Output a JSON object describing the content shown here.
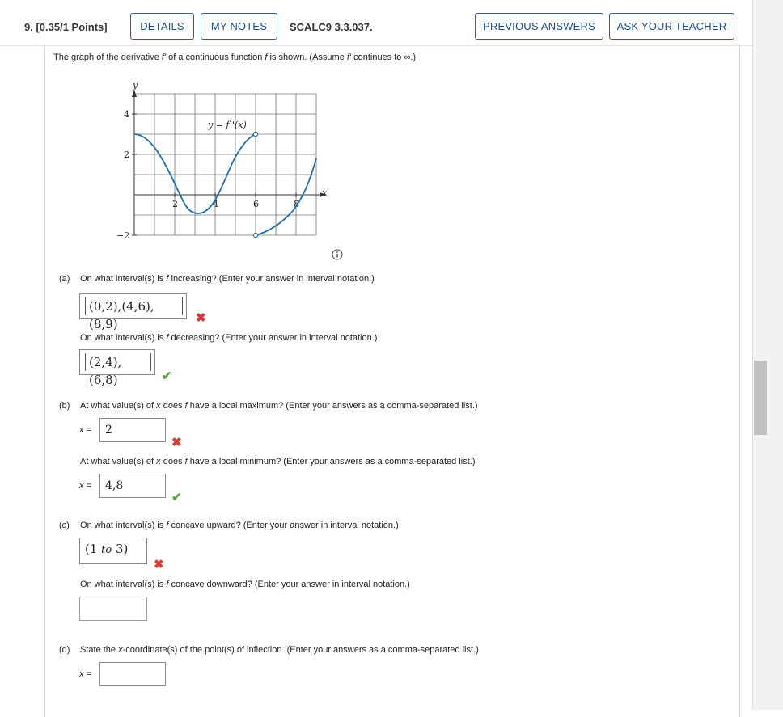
{
  "header": {
    "question_number": "9.",
    "points": "[0.35/1 Points]",
    "details_label": "DETAILS",
    "my_notes_label": "MY NOTES",
    "code": "SCALC9 3.3.037.",
    "previous_answers_label": "PREVIOUS ANSWERS",
    "ask_teacher_label": "ASK YOUR TEACHER"
  },
  "intro": {
    "prefix": "The graph of the derivative ",
    "fprime": "f'",
    "mid": " of a continuous function ",
    "f": "f",
    "mid2": " is shown. (Assume ",
    "fprime2": "f'",
    "suffix": " continues to ∞.)"
  },
  "graph": {
    "y_axis_label": "y",
    "x_axis_label": "x",
    "curve_label": "y = f '(x)",
    "y_ticks": [
      "4",
      "2",
      "−2"
    ],
    "x_ticks": [
      "2",
      "4",
      "6",
      "8"
    ]
  },
  "parts": {
    "a": {
      "label": "(a)",
      "q1_pre": "On what interval(s) is ",
      "q1_f": "f",
      "q1_post": " increasing? (Enter your answer in interval notation.)",
      "a1": "(0,2),(4,6),(8,9)",
      "a1_status": "incorrect",
      "q2_pre": "On what interval(s) is ",
      "q2_f": "f",
      "q2_post": " decreasing? (Enter your answer in interval notation.)",
      "a2": "(2,4),(6,8)",
      "a2_status": "correct"
    },
    "b": {
      "label": "(b)",
      "q1_pre": "At what value(s) of ",
      "q1_x": "x",
      "q1_mid": " does ",
      "q1_f": "f",
      "q1_post": " have a local maximum? (Enter your answers as a comma-separated list.)",
      "x_eq": "x =",
      "a1": "2",
      "a1_status": "incorrect",
      "q2_pre": "At what value(s) of ",
      "q2_x": "x",
      "q2_mid": " does ",
      "q2_f": "f",
      "q2_post": " have a local minimum? (Enter your answers as a comma-separated list.)",
      "a2": "4,8",
      "a2_status": "correct"
    },
    "c": {
      "label": "(c)",
      "q1_pre": "On what interval(s) is ",
      "q1_f": "f",
      "q1_post": " concave upward? (Enter your answer in interval notation.)",
      "a1_open": "(1 ",
      "a1_to": "to",
      "a1_close": " 3)",
      "a1_status": "incorrect",
      "q2_pre": "On what interval(s) is ",
      "q2_f": "f",
      "q2_post": " concave downward? (Enter your answer in interval notation.)",
      "a2": ""
    },
    "d": {
      "label": "(d)",
      "q_pre": "State the ",
      "q_x": "x",
      "q_post": "-coordinate(s) of the point(s) of inflection. (Enter your answers as a comma-separated list.)",
      "x_eq": "x =",
      "a": ""
    }
  },
  "colors": {
    "link_blue": "#1e4f8e",
    "curve_blue": "#1f6fae",
    "incorrect_red": "#d83a3a",
    "correct_green": "#5aa43c"
  }
}
